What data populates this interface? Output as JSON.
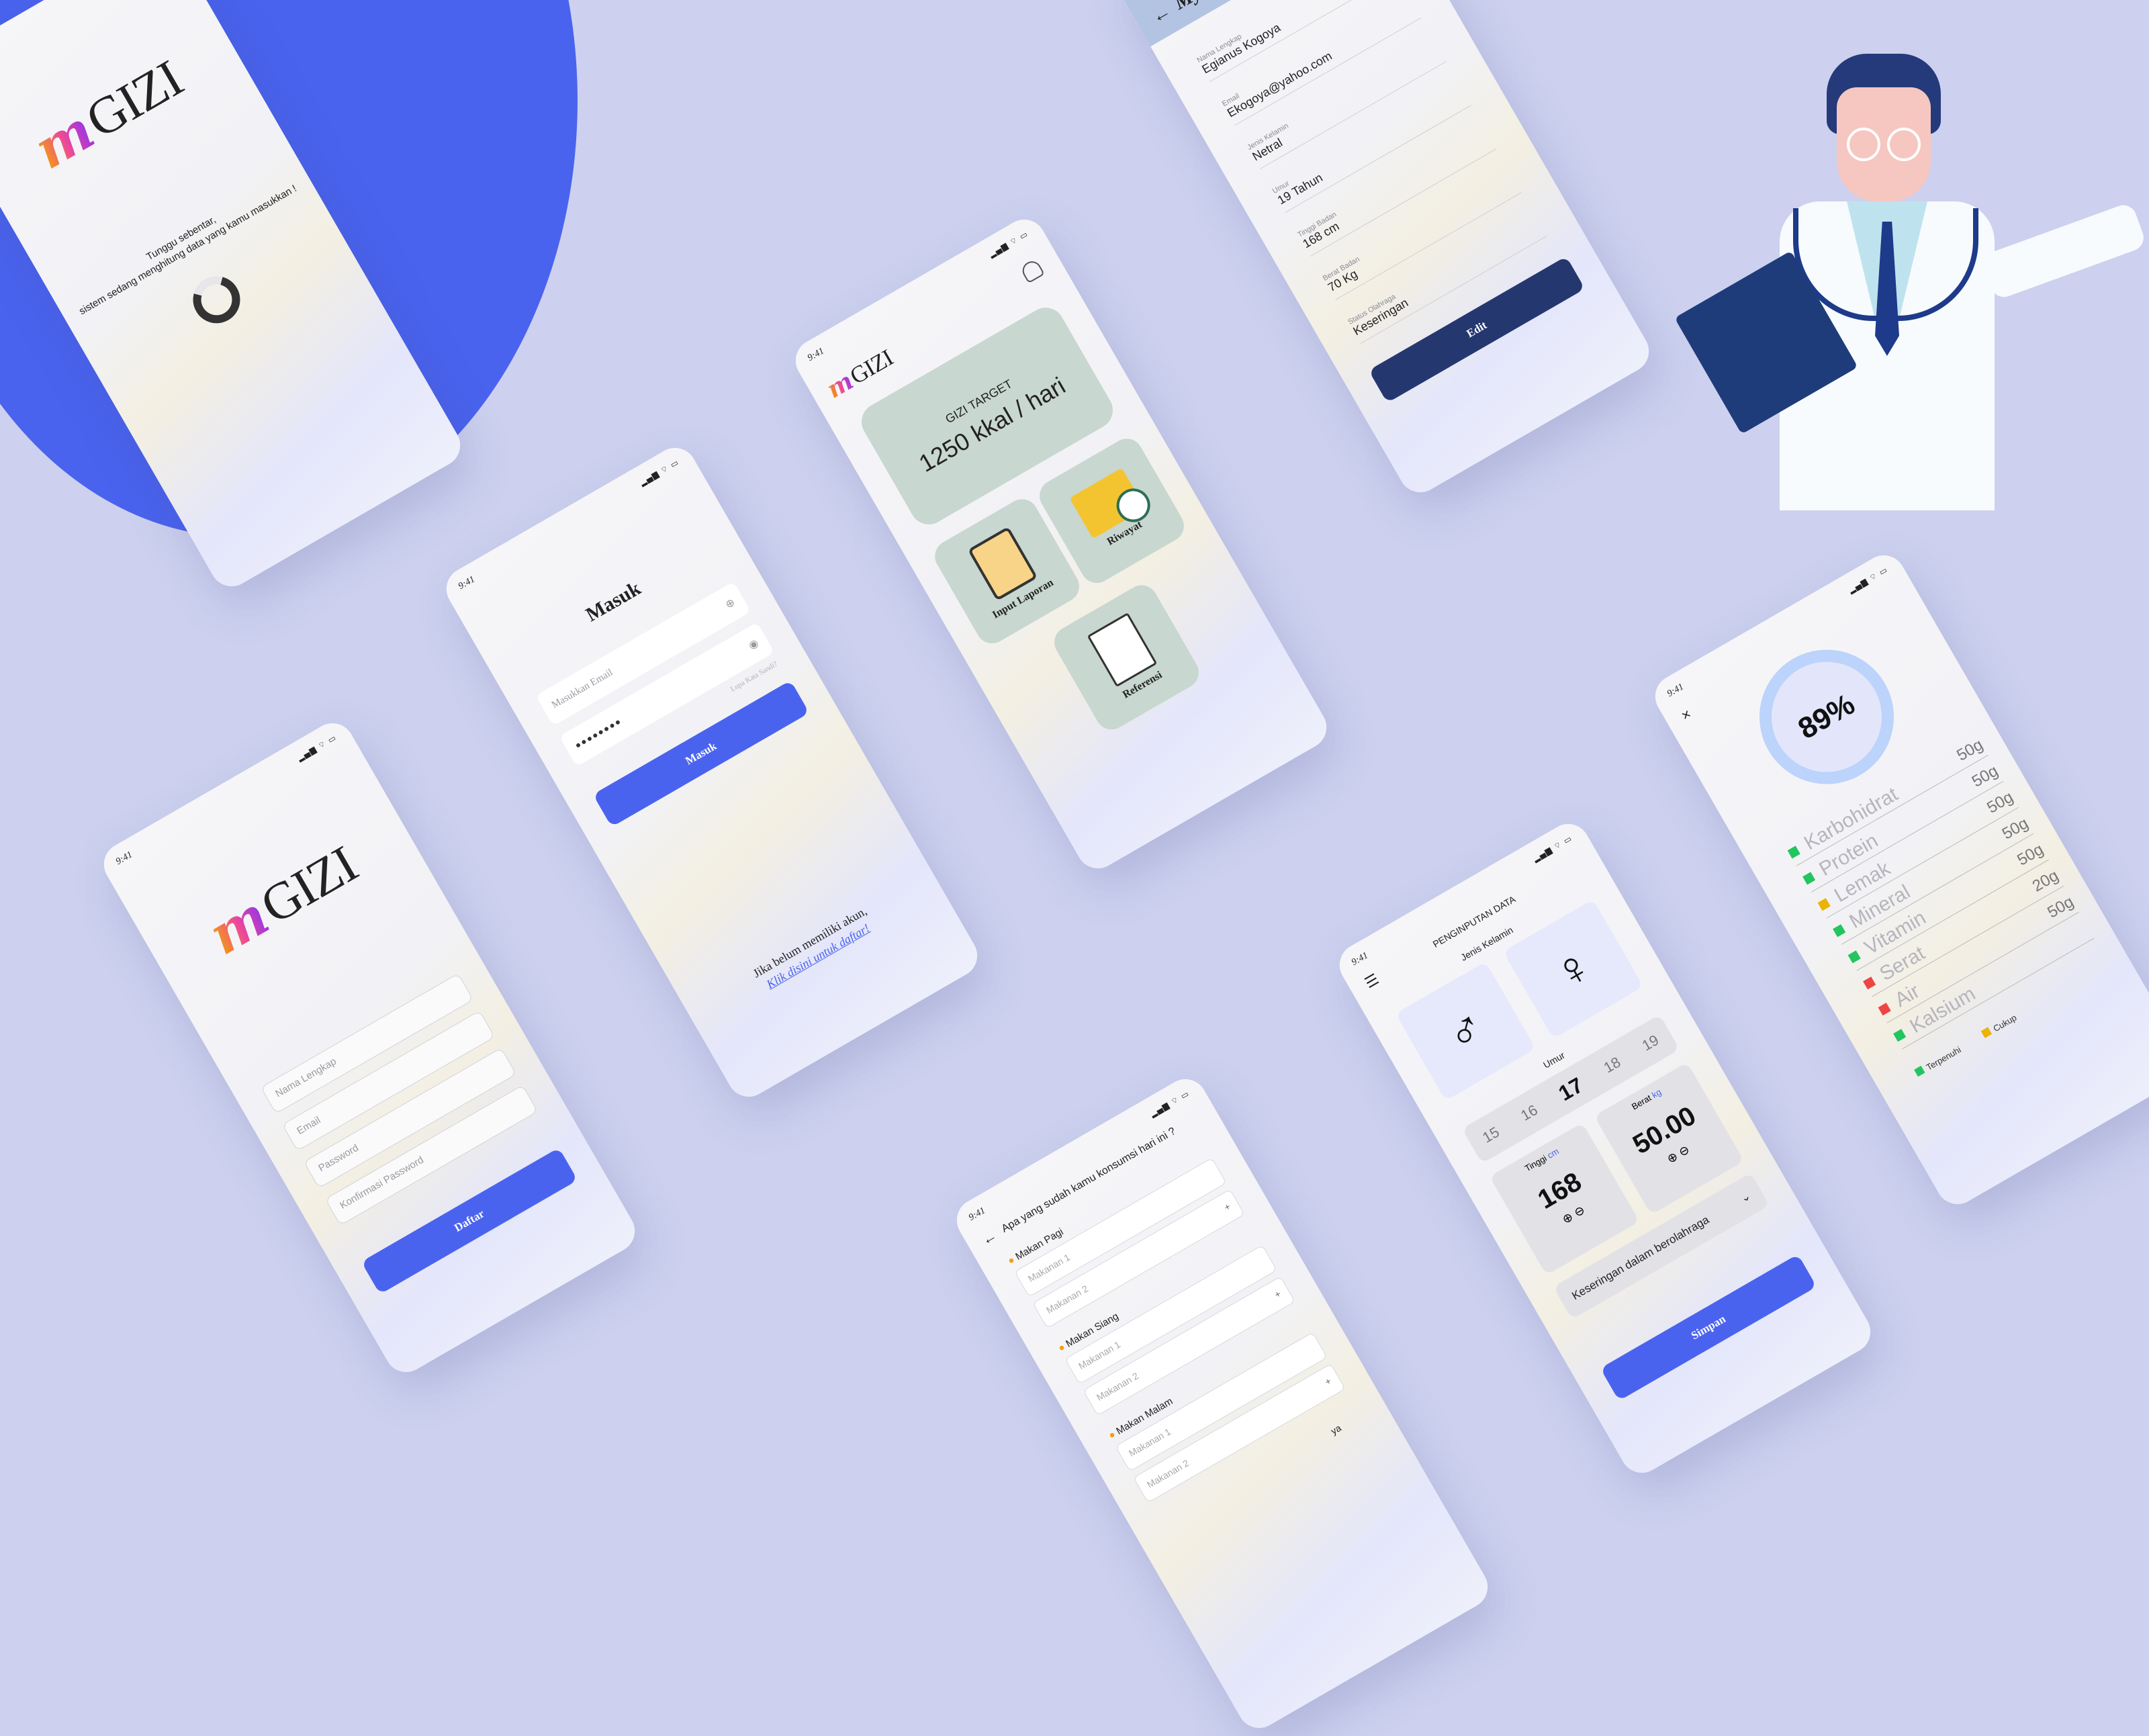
{
  "common": {
    "time": "9:41",
    "status_icons": "▂▄▆ ⌔ ▭"
  },
  "splash": {
    "logo_mark": "m",
    "logo_word": "GIZI",
    "loading_line1": "Tunggu sebentar,",
    "loading_line2": "sistem sedang menghitung data yang kamu masukkan !"
  },
  "login": {
    "title": "Masuk",
    "email_placeholder": "Masukkan Email",
    "password_value": "••••••••",
    "forgot": "Lupa Kata Sandi?",
    "submit": "Masuk",
    "no_account": "Jika belum memiliki akun,",
    "register_link": "Klik disini untuk daftar!"
  },
  "register": {
    "logo_mark": "m",
    "logo_word": "GIZI",
    "fields": [
      "Nama Lengkap",
      "Email",
      "Password",
      "Konfirmasi Password"
    ],
    "submit": "Daftar"
  },
  "dashboard": {
    "logo_mark": "m",
    "logo_word": "GIZI",
    "target_label": "GIZI TARGET",
    "target_value": "1250 kkal / hari",
    "tiles": [
      {
        "label": "Riwayat",
        "icon": "folder-clock-icon"
      },
      {
        "label": "Input Laporan",
        "icon": "clipboard-icon"
      },
      {
        "label": "Referensi",
        "icon": "document-search-icon"
      }
    ]
  },
  "profile": {
    "title": "My Profile",
    "fields": [
      {
        "label": "Nama Lengkap",
        "value": "Egianus Kogoya"
      },
      {
        "label": "Email",
        "value": "Ekogoya@yahoo.com"
      },
      {
        "label": "Jenis Kelamin",
        "value": "Netral"
      },
      {
        "label": "Umur",
        "value": "19 Tahun"
      },
      {
        "label": "Tinggi Badan",
        "value": "168 cm"
      },
      {
        "label": "Berat Badan",
        "value": "70 Kg"
      },
      {
        "label": "Status Olahraga",
        "value": "Keseringan"
      }
    ],
    "edit": "Edit"
  },
  "consumption": {
    "question": "Apa yang sudah kamu konsumsi hari ini ?",
    "meals": [
      {
        "title": "Makan Pagi",
        "items": [
          "Makanan 1",
          "Makanan 2"
        ]
      },
      {
        "title": "Makan Siang",
        "items": [
          "Makanan 1",
          "Makanan 2"
        ]
      },
      {
        "title": "Makan Malam",
        "items": [
          "Makanan 1",
          "Makanan 2"
        ]
      }
    ],
    "footer": "ya"
  },
  "input_data": {
    "title": "PENGINPUTAN DATA",
    "gender_label": "Jenis Kelamin",
    "age_label": "Umur",
    "ages": [
      "15",
      "16",
      "17",
      "18",
      "19"
    ],
    "selected_age": "17",
    "height_label": "Tinggi",
    "height_unit": "cm",
    "height_value": "168",
    "weight_label": "Berat",
    "weight_unit": "kg",
    "weight_value": "50.00",
    "activity": "Keseringan dalam berolahraga",
    "save": "Simpan"
  },
  "nutrition": {
    "percent": "89%",
    "items": [
      {
        "name": "Karbohidrat",
        "value": "50g",
        "color": "#22c55e"
      },
      {
        "name": "Protein",
        "value": "50g",
        "color": "#22c55e"
      },
      {
        "name": "Lemak",
        "value": "50g",
        "color": "#eab308"
      },
      {
        "name": "Mineral",
        "value": "50g",
        "color": "#22c55e"
      },
      {
        "name": "Vitamin",
        "value": "50g",
        "color": "#22c55e"
      },
      {
        "name": "Serat",
        "value": "20g",
        "color": "#ef4444"
      },
      {
        "name": "Air",
        "value": "50g",
        "color": "#ef4444"
      },
      {
        "name": "Kalsium",
        "value": "",
        "color": "#22c55e"
      }
    ],
    "legend": [
      {
        "label": "Terpenuhi",
        "color": "#22c55e"
      },
      {
        "label": "Cukup",
        "color": "#eab308"
      }
    ]
  }
}
